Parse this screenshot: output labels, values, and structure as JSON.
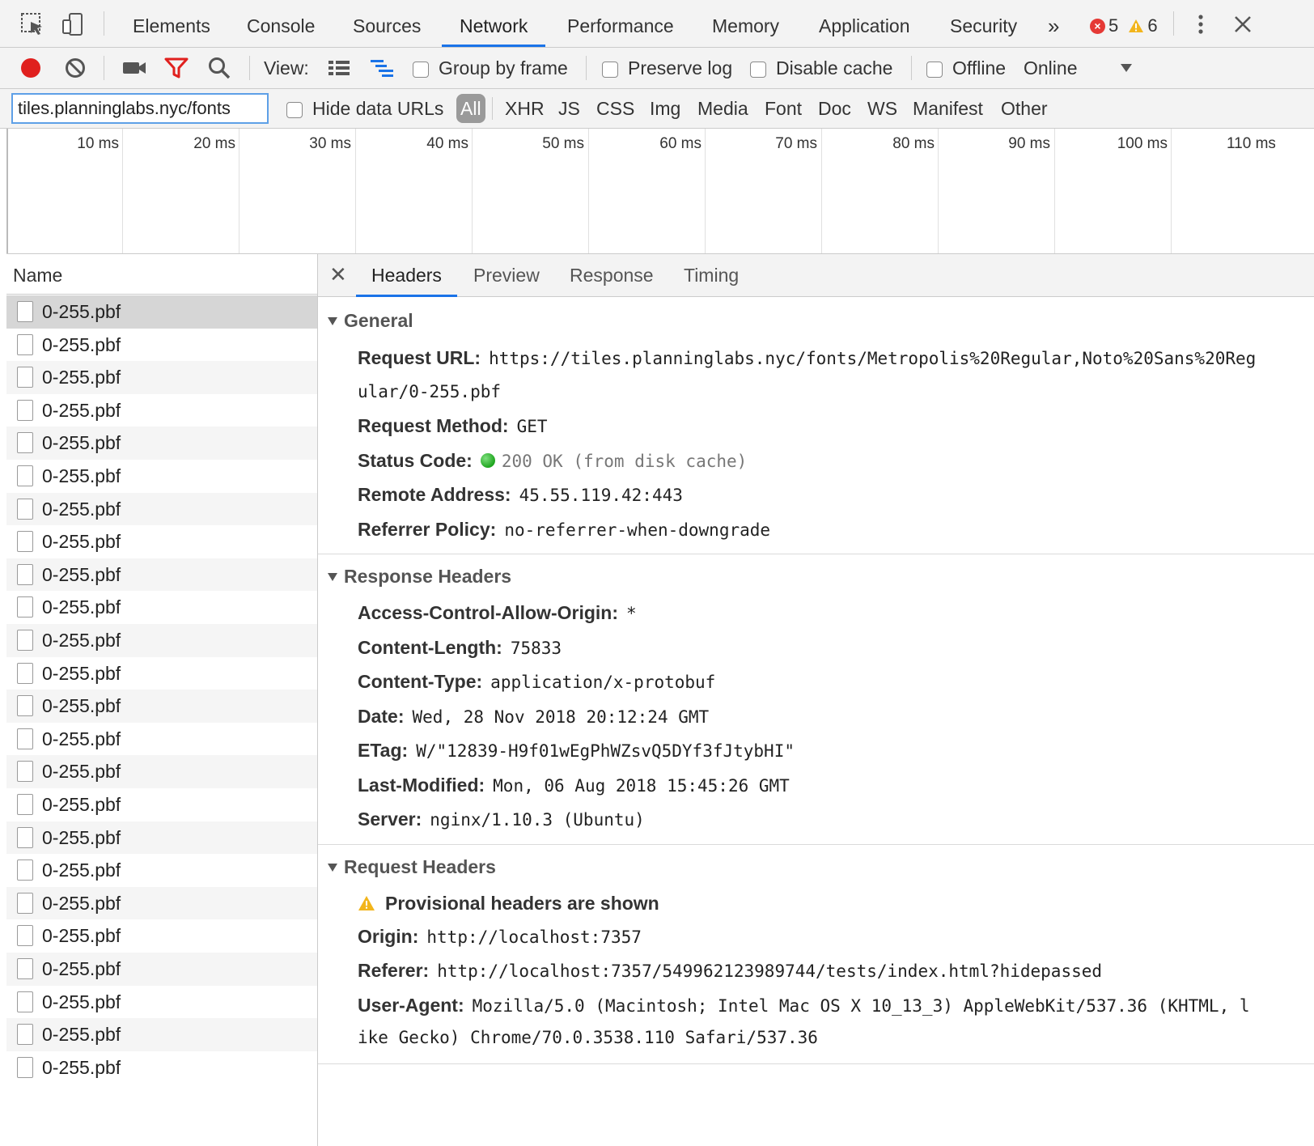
{
  "top_tabs": [
    "Elements",
    "Console",
    "Sources",
    "Network",
    "Performance",
    "Memory",
    "Application",
    "Security"
  ],
  "active_tab": "Network",
  "more_tabs_glyph": "»",
  "error_count": "5",
  "warning_count": "6",
  "toolbar": {
    "view_label": "View:",
    "group_by_frame": "Group by frame",
    "preserve_log": "Preserve log",
    "disable_cache": "Disable cache",
    "offline": "Offline",
    "throttle_value": "Online"
  },
  "filter": {
    "value": "tiles.planninglabs.nyc/fonts",
    "hide_data_urls": "Hide data URLs",
    "types": [
      "All",
      "XHR",
      "JS",
      "CSS",
      "Img",
      "Media",
      "Font",
      "Doc",
      "WS",
      "Manifest",
      "Other"
    ]
  },
  "timeline_labels": [
    "10 ms",
    "20 ms",
    "30 ms",
    "40 ms",
    "50 ms",
    "60 ms",
    "70 ms",
    "80 ms",
    "90 ms",
    "100 ms",
    "110 ms"
  ],
  "name_header": "Name",
  "requests": [
    "0-255.pbf",
    "0-255.pbf",
    "0-255.pbf",
    "0-255.pbf",
    "0-255.pbf",
    "0-255.pbf",
    "0-255.pbf",
    "0-255.pbf",
    "0-255.pbf",
    "0-255.pbf",
    "0-255.pbf",
    "0-255.pbf",
    "0-255.pbf",
    "0-255.pbf",
    "0-255.pbf",
    "0-255.pbf",
    "0-255.pbf",
    "0-255.pbf",
    "0-255.pbf",
    "0-255.pbf",
    "0-255.pbf",
    "0-255.pbf",
    "0-255.pbf",
    "0-255.pbf"
  ],
  "detail_tabs": [
    "Headers",
    "Preview",
    "Response",
    "Timing"
  ],
  "general": {
    "title": "General",
    "request_url_key": "Request URL:",
    "request_url_line1": "https://tiles.planninglabs.nyc/fonts/Metropolis%20Regular,Noto%20Sans%20Reg",
    "request_url_line2": "ular/0-255.pbf",
    "request_method_key": "Request Method:",
    "request_method": "GET",
    "status_code_key": "Status Code:",
    "status_code": "200 OK",
    "status_note": "(from disk cache)",
    "remote_address_key": "Remote Address:",
    "remote_address": "45.55.119.42:443",
    "referrer_policy_key": "Referrer Policy:",
    "referrer_policy": "no-referrer-when-downgrade"
  },
  "response_headers": {
    "title": "Response Headers",
    "items": [
      {
        "k": "Access-Control-Allow-Origin:",
        "v": "*"
      },
      {
        "k": "Content-Length:",
        "v": "75833"
      },
      {
        "k": "Content-Type:",
        "v": "application/x-protobuf"
      },
      {
        "k": "Date:",
        "v": "Wed, 28 Nov 2018 20:12:24 GMT"
      },
      {
        "k": "ETag:",
        "v": "W/\"12839-H9f01wEgPhWZsvQ5DYf3fJtybHI\""
      },
      {
        "k": "Last-Modified:",
        "v": "Mon, 06 Aug 2018 15:45:26 GMT"
      },
      {
        "k": "Server:",
        "v": "nginx/1.10.3 (Ubuntu)"
      }
    ]
  },
  "request_headers": {
    "title": "Request Headers",
    "provisional_warning": "Provisional headers are shown",
    "origin_key": "Origin:",
    "origin": "http://localhost:7357",
    "referer_key": "Referer:",
    "referer": "http://localhost:7357/549962123989744/tests/index.html?hidepassed",
    "user_agent_key": "User-Agent:",
    "user_agent_line1": "Mozilla/5.0 (Macintosh; Intel Mac OS X 10_13_3) AppleWebKit/537.36 (KHTML, l",
    "user_agent_line2": "ike Gecko) Chrome/70.0.3538.110 Safari/537.36"
  },
  "colors": {
    "record": "#e0201e",
    "filter_active": "#e0201e",
    "accent": "#1a73e8",
    "status_ok": "#1fa51f",
    "warning": "#f2b51c"
  }
}
